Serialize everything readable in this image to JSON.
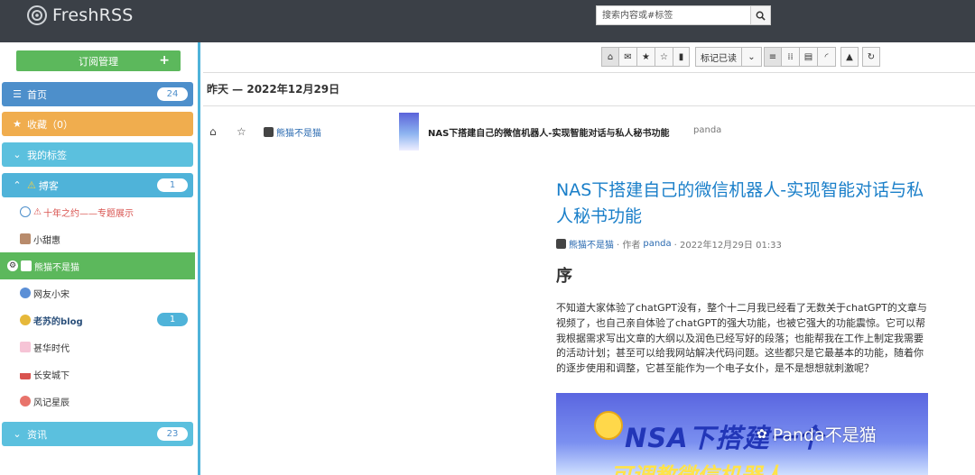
{
  "header": {
    "app_name": "FreshRSS",
    "search_placeholder": "搜索内容或#标签"
  },
  "sidebar": {
    "subscribe_label": "订阅管理",
    "subscribe_plus": "+",
    "categories": [
      {
        "label": "首页",
        "badge": "24",
        "color": "#4d8fcb",
        "icon": "bars-icon"
      },
      {
        "label": "收藏（0）",
        "color": "#f0ad4e",
        "icon": "star-icon"
      },
      {
        "label": "我的标签",
        "color": "#5bc0de",
        "icon": "chevron-down-icon"
      },
      {
        "label": "搏客",
        "badge": "1",
        "color": "#4fb3d9",
        "icon": "chevron-up-icon"
      },
      {
        "label": "资讯",
        "badge": "23",
        "color": "#5bc0de",
        "icon": "chevron-down-icon"
      }
    ],
    "feeds": [
      {
        "label": "十年之约——专题展示",
        "warning": true
      },
      {
        "label": "小甜惠"
      },
      {
        "label": "熊猫不是猫",
        "active": true
      },
      {
        "label": "网友小宋"
      },
      {
        "label": "老苏的blog",
        "badge": "1"
      },
      {
        "label": "甚华时代"
      },
      {
        "label": "长安城下"
      },
      {
        "label": "风记星辰"
      }
    ]
  },
  "toolbar": {
    "mark_read": "标记已读"
  },
  "date_line": "昨天 — 2022年12月29日",
  "article_row": {
    "source": "熊猫不是猫",
    "title": "NAS下搭建自己的微信机器人-实现智能对话与私人秘书功能",
    "author": "panda"
  },
  "article": {
    "title": "NAS下搭建自己的微信机器人-实现智能对话与私人秘书功能",
    "source": "熊猫不是猫",
    "meta_by": "· 作者",
    "author": "panda",
    "date": "· 2022年12月29日 01:33",
    "heading": "序",
    "paragraph": "不知道大家体验了chatGPT没有，整个十二月我已经看了无数关于chatGPT的文章与视频了，也自己亲自体验了chatGPT的强大功能，也被它强大的功能震惊。它可以帮我根据需求写出文章的大纲以及润色已经写好的段落；也能帮我在工作上制定我需要的活动计划；甚至可以给我网站解决代码问题。这些都只是它最基本的功能，随着你的逐步使用和调整，它甚至能作为一个电子女仆，是不是想想就刺激呢？",
    "banner_text": "NSA下搭建一个",
    "banner_text2": "可调教微信机器人",
    "watermark": "Panda不是猫"
  }
}
